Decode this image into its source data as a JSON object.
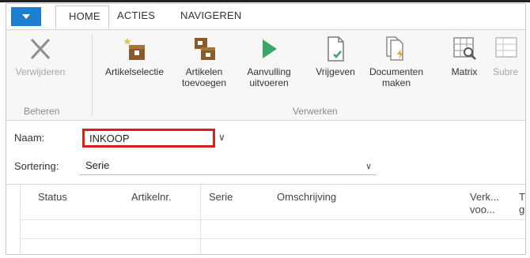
{
  "tabs": {
    "home": "HOME",
    "acties": "ACTIES",
    "navigeren": "NAVIGEREN"
  },
  "ribbon": {
    "verwijderen": "Verwijderen",
    "artikelselectie": "Artikelselectie",
    "artikelen_toevoegen_1": "Artikelen",
    "artikelen_toevoegen_2": "toevoegen",
    "aanvulling_1": "Aanvulling",
    "aanvulling_2": "uitvoeren",
    "vrijgeven": "Vrijgeven",
    "documenten_1": "Documenten",
    "documenten_2": "maken",
    "matrix": "Matrix",
    "subre": "Subre",
    "group_beheren": "Beheren",
    "group_verwerken": "Verwerken"
  },
  "form": {
    "naam_label": "Naam:",
    "naam_value": "INKOOP",
    "sortering_label": "Sortering:",
    "sortering_value": "Serie"
  },
  "grid": {
    "col_status": "Status",
    "col_artikelnr": "Artikelnr.",
    "col_serie": "Serie",
    "col_omschrijving": "Omschrijving",
    "col_verk_1": "Verk...",
    "col_verk_2": "voo...",
    "col_t_1": "T",
    "col_t_2": "g"
  },
  "colors": {
    "accent": "#1e7fcf",
    "highlight": "#d81f1f"
  }
}
